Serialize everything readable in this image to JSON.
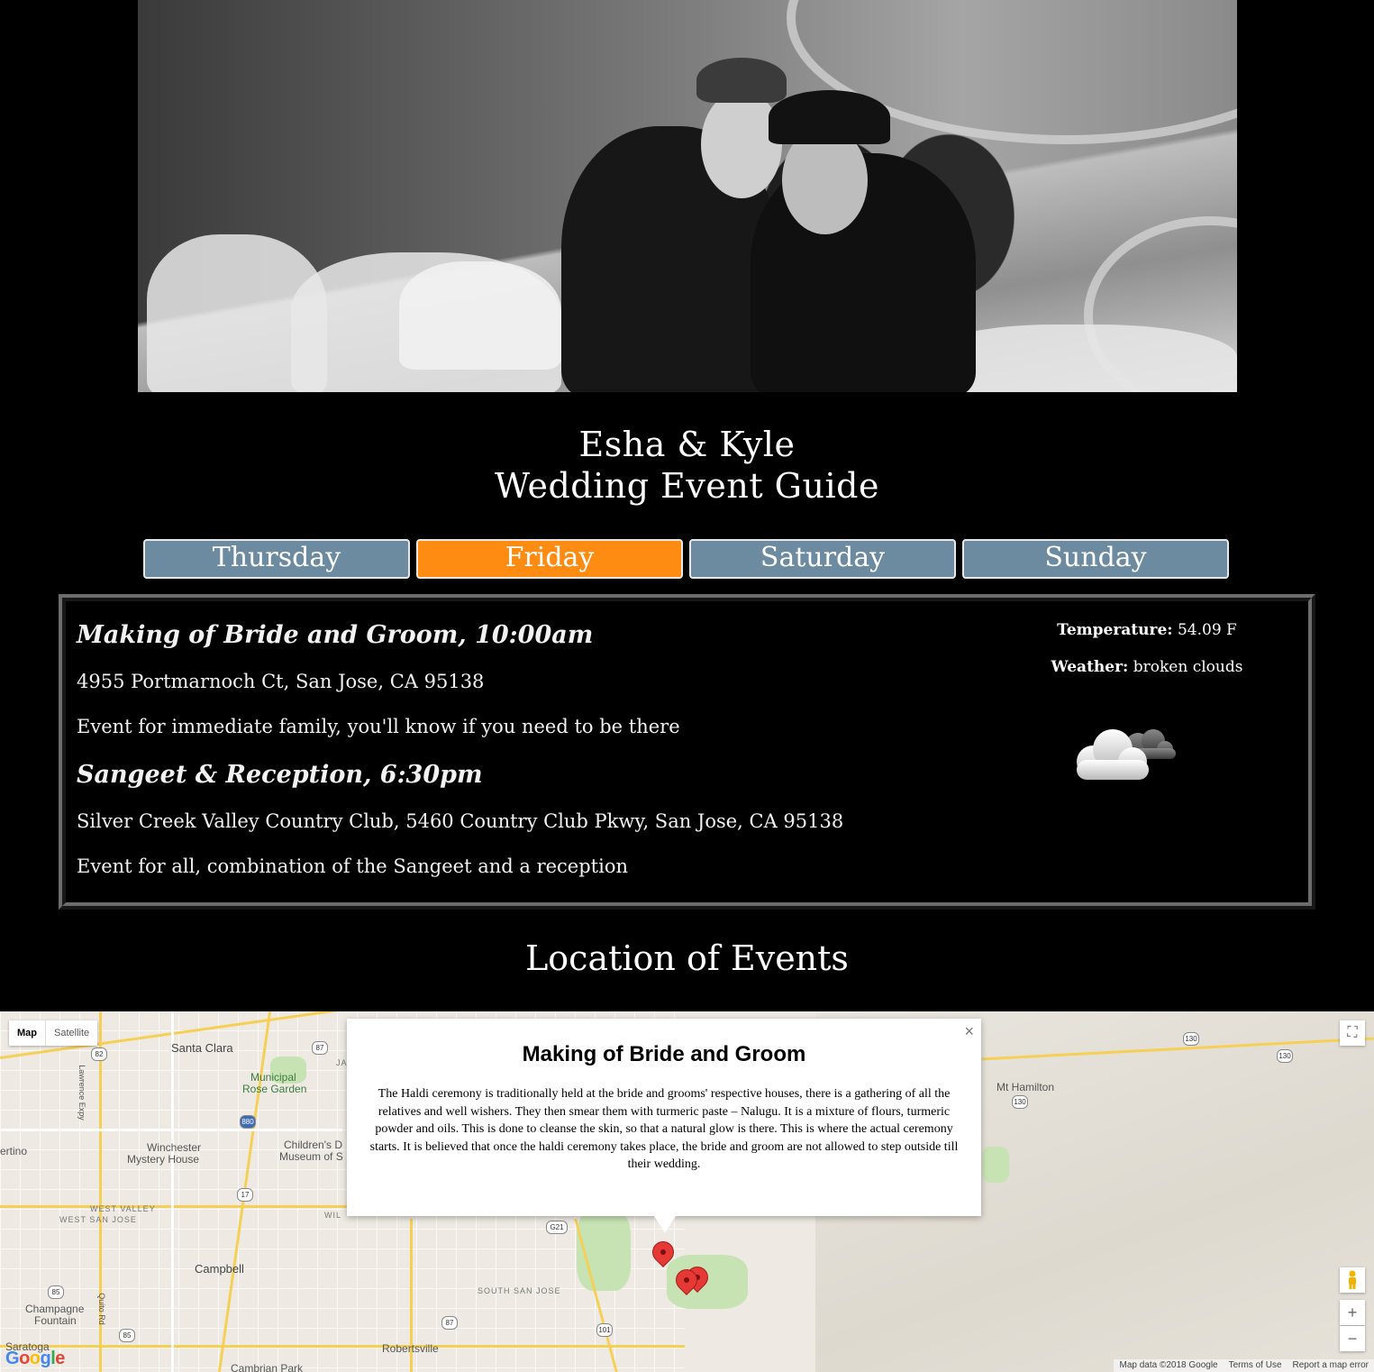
{
  "header": {
    "photo_alt": "Black and white photo of couple on a mountain",
    "title_line1": "Esha & Kyle",
    "title_line2": "Wedding Event Guide"
  },
  "tabs": [
    {
      "label": "Thursday",
      "active": false
    },
    {
      "label": "Friday",
      "active": true
    },
    {
      "label": "Saturday",
      "active": false
    },
    {
      "label": "Sunday",
      "active": false
    }
  ],
  "events": [
    {
      "title": "Making of Bride and Groom, 10:00am",
      "address": "4955 Portmarnoch Ct, San Jose, CA 95138",
      "description": "Event for immediate family, you'll know if you need to be there"
    },
    {
      "title": "Sangeet & Reception, 6:30pm",
      "address": "Silver Creek Valley Country Club, 5460 Country Club Pkwy, San Jose, CA 95138",
      "description": "Event for all, combination of the Sangeet and a reception"
    }
  ],
  "weather": {
    "temperature_label": "Temperature:",
    "temperature_value": " 54.09 F",
    "weather_label": "Weather:",
    "weather_value": " broken clouds",
    "icon": "broken-clouds-icon"
  },
  "location_title": "Location of Events",
  "map": {
    "map_type_options": [
      "Map",
      "Satellite"
    ],
    "selected_map_type": "Map",
    "labels": {
      "santa_clara": "Santa Clara",
      "municipal": "Municipal",
      "rose_garden": "Rose Garden",
      "winchester": "Winchester",
      "mystery_house": "Mystery House",
      "childrens": "Children's D",
      "museum": "Museum of S",
      "west_valley": "WEST VALLEY",
      "west_san_jose": "WEST SAN JOSE",
      "campbell": "Campbell",
      "champagne": "Champagne",
      "fountain": "Fountain",
      "south_san_jose": "SOUTH SAN JOSE",
      "robertsville": "Robertsville",
      "cambrian_park": "Cambrian Park",
      "saratoga": "Saratoga",
      "mt_hamilton": "Mt Hamilton",
      "lawrence_expy": "Lawrence Expy",
      "quito_rd": "Quito Rd",
      "ertino": "ertino",
      "wil": "WIL",
      "ja": "JA"
    },
    "shields": [
      "82",
      "87",
      "880",
      "17",
      "85",
      "85",
      "87",
      "101",
      "G21",
      "130",
      "130",
      "130"
    ],
    "info_window": {
      "title": "Making of Bride and Groom",
      "body": "The Haldi ceremony is traditionally held at the bride and grooms' respective houses, there is a gathering of all the relatives and well wishers. They then smear them with turmeric paste – Nalugu. It is a mixture of flours, turmeric powder and oils. This is done to cleanse the skin, so that a natural glow is there. This is where the actual ceremony starts. It is believed that once the haldi ceremony takes place, the bride and groom are not allowed to step outside till their wedding.",
      "close": "×"
    },
    "zoom_in": "+",
    "zoom_out": "−",
    "fullscreen": "⛶",
    "logo": "Google",
    "attribution": [
      "Map data ©2018 Google",
      "Terms of Use",
      "Report a map error"
    ]
  }
}
